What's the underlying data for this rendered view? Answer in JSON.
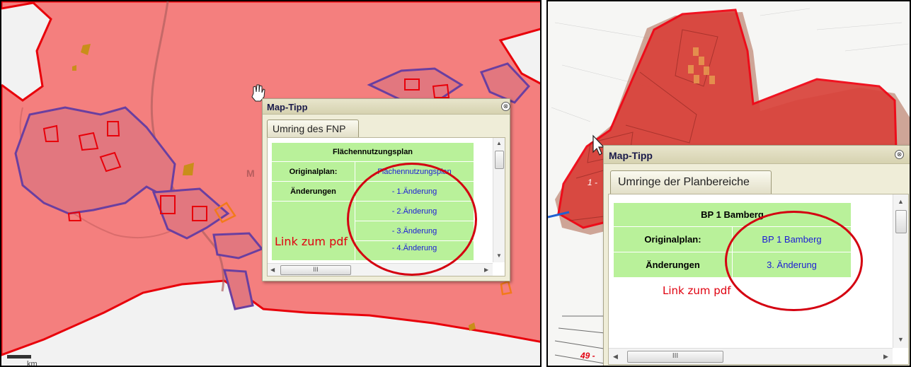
{
  "colors": {
    "map_fill": "#f47f7e",
    "boundary": "#e8000a",
    "plan_outline": "#6a3fa0",
    "table_green": "#b9f19a",
    "link_blue": "#1b1bd6",
    "annotation_red": "#e0000f"
  },
  "left": {
    "map_label": "M",
    "scale_label": "km",
    "popup": {
      "title": "Map-Tipp",
      "close_icon": "⊗",
      "tab": "Umring des FNP",
      "table": {
        "header": "Flächennutzungsplan",
        "original_label": "Originalplan:",
        "original_link": "Flächennutzungsplan",
        "changes_label": "Änderungen",
        "changes": [
          "- 1.Änderung",
          "- 2.Änderung",
          "- 3.Änderung",
          "- 4.Änderung"
        ]
      },
      "hscroll_grip": "III"
    },
    "annotation": "Link zum pdf"
  },
  "right": {
    "map_label_1": "1 -",
    "map_label_49": "49 -",
    "popup": {
      "title": "Map-Tipp",
      "close_icon": "⊗",
      "tab": "Umringe der Planbereiche",
      "table": {
        "header": "BP 1 Bamberg",
        "original_label": "Originalplan:",
        "original_link": "BP 1 Bamberg",
        "changes_label": "Änderungen",
        "changes_link": "3. Änderung"
      },
      "hscroll_grip": "III"
    },
    "annotation": "Link zum pdf"
  }
}
